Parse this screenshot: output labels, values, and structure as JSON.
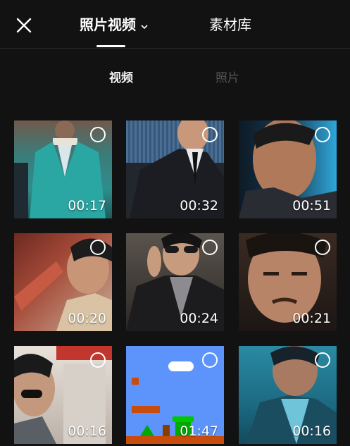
{
  "header": {
    "tab_photos_videos": "照片视频",
    "tab_material_library": "素材库"
  },
  "filters": {
    "video": "视频",
    "photo": "照片"
  },
  "colors": {
    "background": "#121212",
    "active_text": "#f2f2f2",
    "inactive_text": "#555555"
  },
  "media": [
    {
      "duration": "00:17"
    },
    {
      "duration": "00:32"
    },
    {
      "duration": "00:51"
    },
    {
      "duration": "00:20"
    },
    {
      "duration": "00:24"
    },
    {
      "duration": "00:21"
    },
    {
      "duration": "00:16"
    },
    {
      "duration": "01:47"
    },
    {
      "duration": "00:16"
    }
  ]
}
